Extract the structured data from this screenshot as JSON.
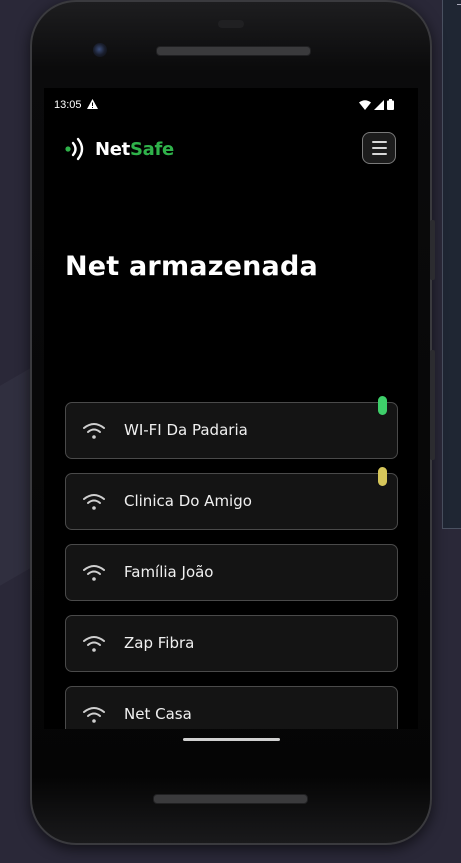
{
  "status_bar": {
    "time": "13:05"
  },
  "header": {
    "logo_part1": "Net",
    "logo_part2": "Safe",
    "menu_icon": "hamburger-icon"
  },
  "page": {
    "title": "Net armazenada"
  },
  "networks": [
    {
      "name": "WI-FI Da Padaria",
      "status_color": "#3ecf6a"
    },
    {
      "name": "Clinica Do Amigo",
      "status_color": "#d6c65a"
    },
    {
      "name": "Família João",
      "status_color": null
    },
    {
      "name": "Zap Fibra",
      "status_color": null
    },
    {
      "name": "Net Casa",
      "status_color": null
    }
  ],
  "colors": {
    "brand_green": "#2fb24a",
    "background": "#000000",
    "card": "#141414"
  }
}
